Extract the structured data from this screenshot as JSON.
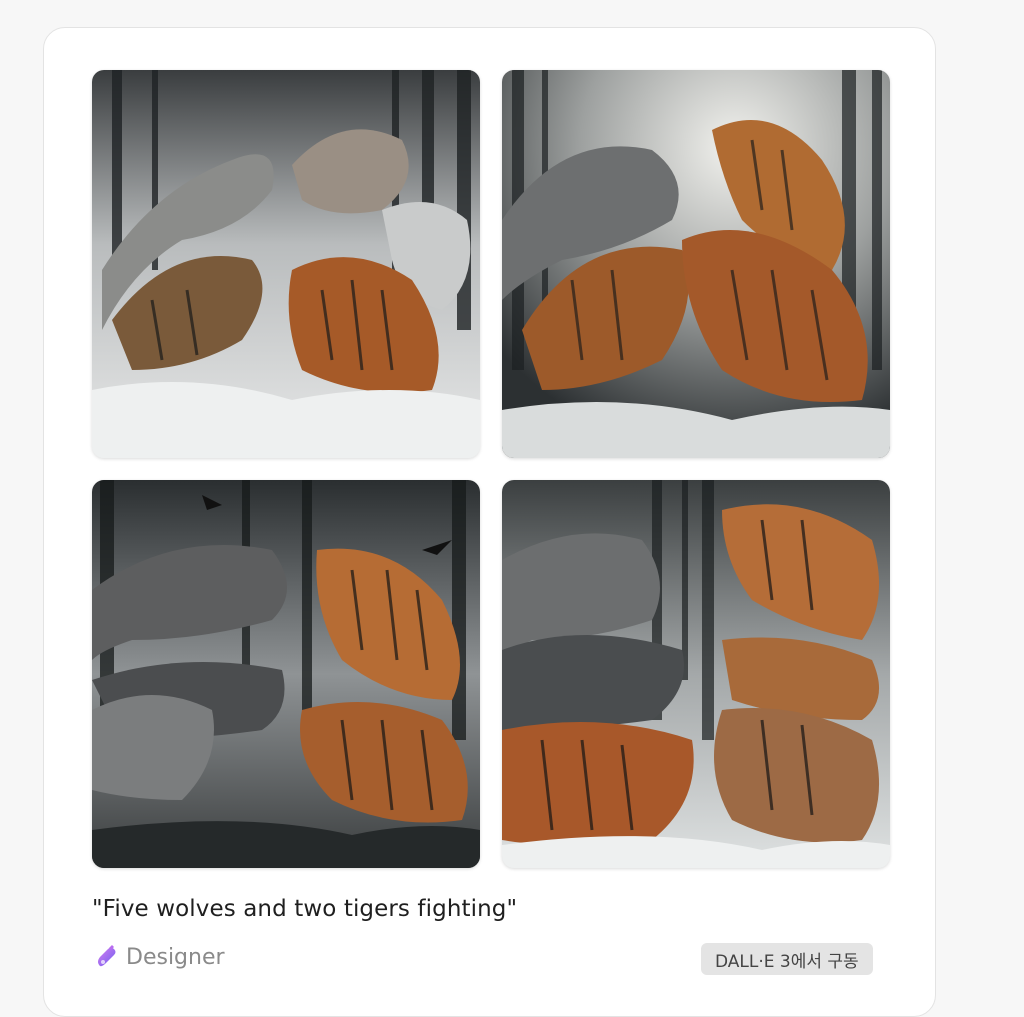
{
  "card": {
    "prompt": "\"Five wolves and two tigers fighting\"",
    "brand": {
      "name": "Designer",
      "icon": "designer-logo-icon"
    },
    "badge": "DALL·E 3에서 구동"
  },
  "images": [
    {
      "subject": "wolves-and-tigers-fighting-1"
    },
    {
      "subject": "wolves-and-tigers-fighting-2"
    },
    {
      "subject": "wolves-and-tigers-fighting-3"
    },
    {
      "subject": "wolves-and-tigers-fighting-4"
    }
  ],
  "colors": {
    "card_bg": "#ffffff",
    "page_bg": "#f7f7f7",
    "badge_bg": "#e4e4e4",
    "brand_gradient_start": "#c66cf0",
    "brand_gradient_end": "#7a5cf0"
  }
}
